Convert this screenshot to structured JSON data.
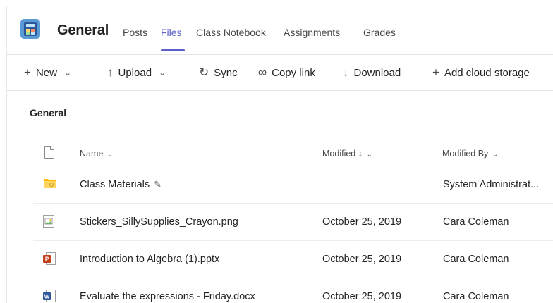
{
  "header": {
    "channel_title": "General",
    "tabs": [
      {
        "label": "Posts"
      },
      {
        "label": "Files"
      },
      {
        "label": "Class Notebook"
      },
      {
        "label": "Assignments"
      },
      {
        "label": "Grades"
      }
    ],
    "active_tab": "Files"
  },
  "toolbar": {
    "new_label": "New",
    "upload_label": "Upload",
    "sync_label": "Sync",
    "copy_link_label": "Copy link",
    "download_label": "Download",
    "add_cloud_label": "Add cloud storage"
  },
  "section_title": "General",
  "table": {
    "col_name": "Name",
    "col_modified": "Modified ↓",
    "col_modified_by": "Modified By",
    "rows": [
      {
        "name": "Class Materials",
        "modified": "",
        "modified_by": "System Administrat...",
        "type": "folder-icon"
      },
      {
        "name": "Stickers_SillySupplies_Crayon.png",
        "modified": "October 25, 2019",
        "modified_by": "Cara Coleman",
        "type": "image-file-icon"
      },
      {
        "name": "Introduction to Algebra (1).pptx",
        "modified": "October 25, 2019",
        "modified_by": "Cara Coleman",
        "type": "powerpoint-file-icon"
      },
      {
        "name": "Evaluate the expressions - Friday.docx",
        "modified": "October 25, 2019",
        "modified_by": "Cara Coleman",
        "type": "word-file-icon"
      }
    ]
  },
  "colors": {
    "accent": "#5b5fc7",
    "folder": "#ffb900",
    "powerpoint": "#c43e1c",
    "word": "#2b579a"
  }
}
